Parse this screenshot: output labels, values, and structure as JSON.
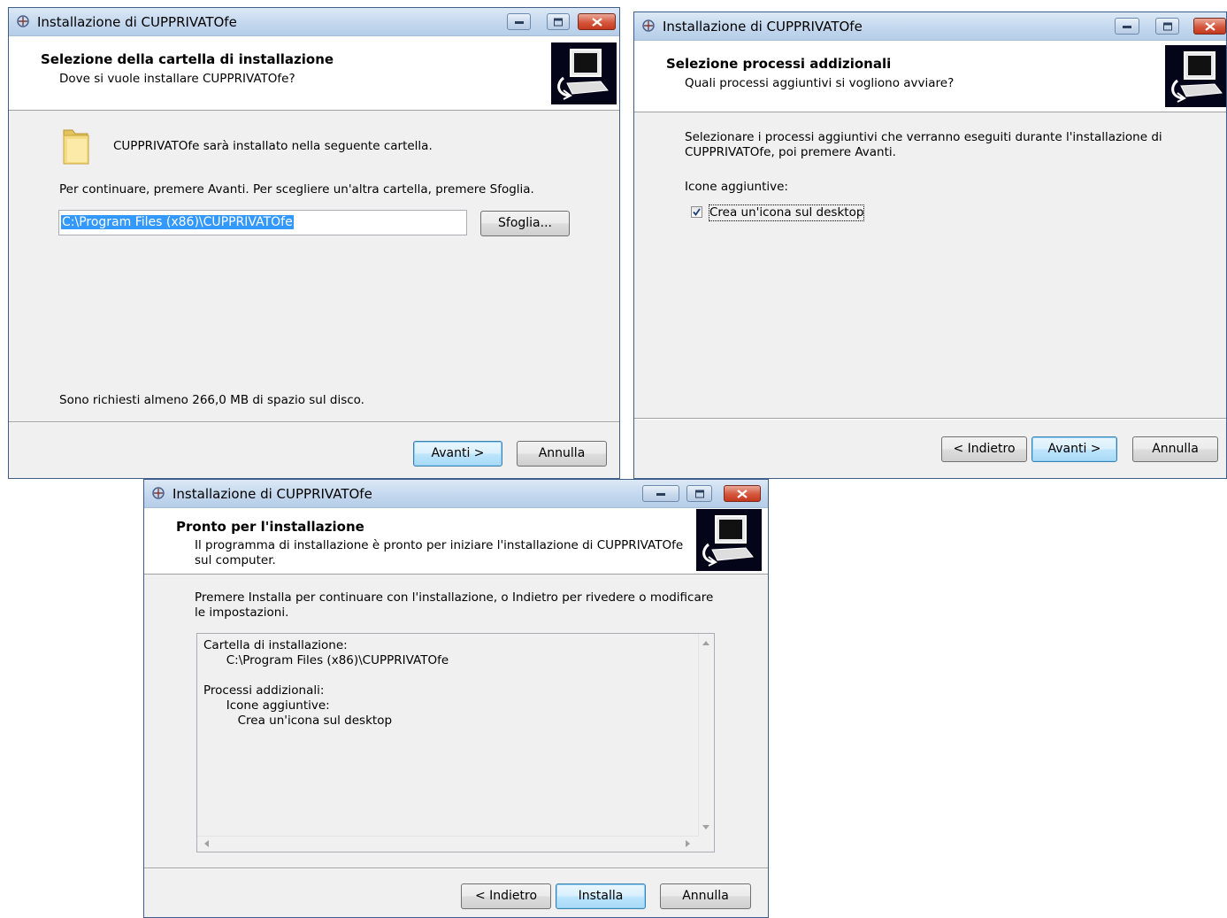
{
  "app_title": "Installazione di CUPPRIVATOfe",
  "window1": {
    "header_title": "Selezione della cartella di installazione",
    "header_subtitle": "Dove si vuole installare CUPPRIVATOfe?",
    "folder_message": "CUPPRIVATOfe sarà installato nella seguente cartella.",
    "instruction": "Per continuare, premere Avanti. Per scegliere un'altra cartella, premere Sfoglia.",
    "install_path": "C:\\Program Files (x86)\\CUPPRIVATOfe",
    "browse_button": "Sfoglia...",
    "disk_space": "Sono richiesti almeno 266,0 MB di spazio sul disco.",
    "next_button": "Avanti >",
    "cancel_button": "Annulla"
  },
  "window2": {
    "header_title": "Selezione processi addizionali",
    "header_subtitle": "Quali processi aggiuntivi si vogliono avviare?",
    "instruction_line1": "Selezionare i processi aggiuntivi che verranno eseguiti durante l'installazione di",
    "instruction_line2": "CUPPRIVATOfe, poi premere Avanti.",
    "group_label": "Icone aggiuntive:",
    "checkbox_label": "Crea un'icona sul desktop",
    "checkbox_checked": true,
    "back_button": "< Indietro",
    "next_button": "Avanti >",
    "cancel_button": "Annulla"
  },
  "window3": {
    "header_title": "Pronto per l'installazione",
    "header_subtitle_line1": "Il programma di installazione è pronto per iniziare l'installazione di CUPPRIVATOfe",
    "header_subtitle_line2": "sul computer.",
    "instruction_line1": "Premere Installa per continuare con l'installazione, o Indietro per rivedere o modificare",
    "instruction_line2": "le impostazioni.",
    "summary": "Cartella di installazione:\n      C:\\Program Files (x86)\\CUPPRIVATOfe\n\nProcessi addizionali:\n      Icone aggiuntive:\n         Crea un'icona sul desktop",
    "back_button": "< Indietro",
    "install_button": "Installa",
    "cancel_button": "Annulla"
  },
  "icons": [
    "setup-app-icon",
    "minimize-icon",
    "maximize-icon",
    "close-icon",
    "folder-icon",
    "wizard-computer-icon",
    "checkmark-icon",
    "scroll-arrow-icon"
  ],
  "colors": {
    "titlebar": "#c4d8ee",
    "selection": "#3399ff",
    "close_button": "#d5573d",
    "wizard_image_bg": "#05051a"
  }
}
